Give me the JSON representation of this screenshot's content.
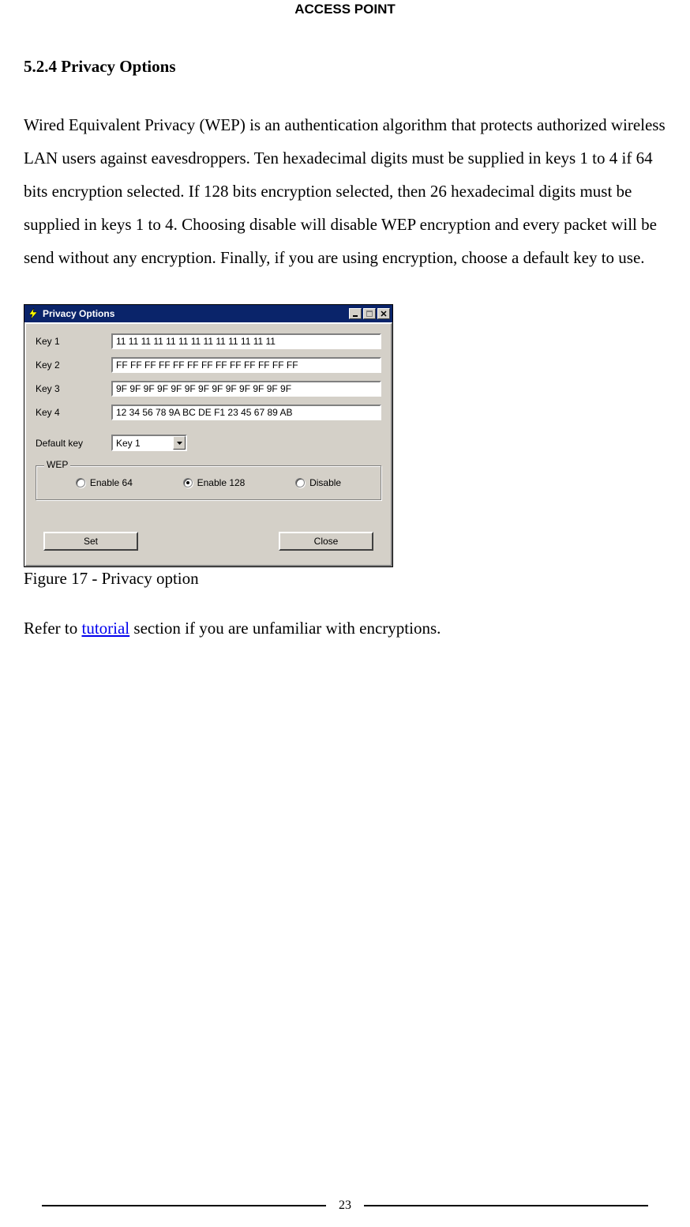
{
  "header": {
    "title": "ACCESS POINT"
  },
  "section": {
    "heading": "5.2.4 Privacy Options"
  },
  "paragraph": "Wired Equivalent Privacy (WEP) is an authentication algorithm that protects authorized wireless LAN users against eavesdroppers. Ten hexadecimal digits must be supplied in keys 1 to 4 if 64 bits encryption selected. If 128 bits encryption selected, then 26 hexadecimal digits must be supplied in keys 1 to 4. Choosing disable will disable WEP encryption and every packet will be send without any encryption. Finally, if you are using encryption, choose a default key to use.",
  "dialog": {
    "title": "Privacy Options",
    "keys": {
      "label1": "Key 1",
      "value1": "11 11 11 11 11 11 11 11 11 11 11 11 11",
      "label2": "Key 2",
      "value2": "FF FF FF FF FF FF FF FF FF FF FF FF FF",
      "label3": "Key 3",
      "value3": "9F 9F 9F 9F 9F 9F 9F 9F 9F 9F 9F 9F 9F",
      "label4": "Key 4",
      "value4": "12 34 56 78 9A BC DE F1 23 45 67 89 AB"
    },
    "default_key": {
      "label": "Default key",
      "value": "Key 1"
    },
    "wep": {
      "legend": "WEP",
      "opt1": "Enable 64",
      "opt2": "Enable 128",
      "opt3": "Disable",
      "selected_index": 1
    },
    "buttons": {
      "set": "Set",
      "close": "Close"
    }
  },
  "caption": "Figure 17 - Privacy option",
  "refer": {
    "pre": "Refer to ",
    "link": "tutorial",
    "post": " section if you are unfamiliar with encryptions."
  },
  "footer": {
    "page": "23"
  }
}
